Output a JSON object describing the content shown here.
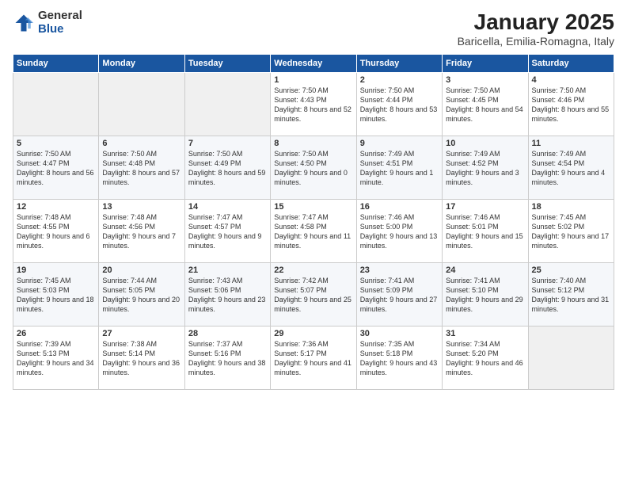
{
  "logo": {
    "general": "General",
    "blue": "Blue"
  },
  "title": "January 2025",
  "subtitle": "Baricella, Emilia-Romagna, Italy",
  "weekdays": [
    "Sunday",
    "Monday",
    "Tuesday",
    "Wednesday",
    "Thursday",
    "Friday",
    "Saturday"
  ],
  "weeks": [
    [
      {
        "day": "",
        "info": ""
      },
      {
        "day": "",
        "info": ""
      },
      {
        "day": "",
        "info": ""
      },
      {
        "day": "1",
        "info": "Sunrise: 7:50 AM\nSunset: 4:43 PM\nDaylight: 8 hours\nand 52 minutes."
      },
      {
        "day": "2",
        "info": "Sunrise: 7:50 AM\nSunset: 4:44 PM\nDaylight: 8 hours\nand 53 minutes."
      },
      {
        "day": "3",
        "info": "Sunrise: 7:50 AM\nSunset: 4:45 PM\nDaylight: 8 hours\nand 54 minutes."
      },
      {
        "day": "4",
        "info": "Sunrise: 7:50 AM\nSunset: 4:46 PM\nDaylight: 8 hours\nand 55 minutes."
      }
    ],
    [
      {
        "day": "5",
        "info": "Sunrise: 7:50 AM\nSunset: 4:47 PM\nDaylight: 8 hours\nand 56 minutes."
      },
      {
        "day": "6",
        "info": "Sunrise: 7:50 AM\nSunset: 4:48 PM\nDaylight: 8 hours\nand 57 minutes."
      },
      {
        "day": "7",
        "info": "Sunrise: 7:50 AM\nSunset: 4:49 PM\nDaylight: 8 hours\nand 59 minutes."
      },
      {
        "day": "8",
        "info": "Sunrise: 7:50 AM\nSunset: 4:50 PM\nDaylight: 9 hours\nand 0 minutes."
      },
      {
        "day": "9",
        "info": "Sunrise: 7:49 AM\nSunset: 4:51 PM\nDaylight: 9 hours\nand 1 minute."
      },
      {
        "day": "10",
        "info": "Sunrise: 7:49 AM\nSunset: 4:52 PM\nDaylight: 9 hours\nand 3 minutes."
      },
      {
        "day": "11",
        "info": "Sunrise: 7:49 AM\nSunset: 4:54 PM\nDaylight: 9 hours\nand 4 minutes."
      }
    ],
    [
      {
        "day": "12",
        "info": "Sunrise: 7:48 AM\nSunset: 4:55 PM\nDaylight: 9 hours\nand 6 minutes."
      },
      {
        "day": "13",
        "info": "Sunrise: 7:48 AM\nSunset: 4:56 PM\nDaylight: 9 hours\nand 7 minutes."
      },
      {
        "day": "14",
        "info": "Sunrise: 7:47 AM\nSunset: 4:57 PM\nDaylight: 9 hours\nand 9 minutes."
      },
      {
        "day": "15",
        "info": "Sunrise: 7:47 AM\nSunset: 4:58 PM\nDaylight: 9 hours\nand 11 minutes."
      },
      {
        "day": "16",
        "info": "Sunrise: 7:46 AM\nSunset: 5:00 PM\nDaylight: 9 hours\nand 13 minutes."
      },
      {
        "day": "17",
        "info": "Sunrise: 7:46 AM\nSunset: 5:01 PM\nDaylight: 9 hours\nand 15 minutes."
      },
      {
        "day": "18",
        "info": "Sunrise: 7:45 AM\nSunset: 5:02 PM\nDaylight: 9 hours\nand 17 minutes."
      }
    ],
    [
      {
        "day": "19",
        "info": "Sunrise: 7:45 AM\nSunset: 5:03 PM\nDaylight: 9 hours\nand 18 minutes."
      },
      {
        "day": "20",
        "info": "Sunrise: 7:44 AM\nSunset: 5:05 PM\nDaylight: 9 hours\nand 20 minutes."
      },
      {
        "day": "21",
        "info": "Sunrise: 7:43 AM\nSunset: 5:06 PM\nDaylight: 9 hours\nand 23 minutes."
      },
      {
        "day": "22",
        "info": "Sunrise: 7:42 AM\nSunset: 5:07 PM\nDaylight: 9 hours\nand 25 minutes."
      },
      {
        "day": "23",
        "info": "Sunrise: 7:41 AM\nSunset: 5:09 PM\nDaylight: 9 hours\nand 27 minutes."
      },
      {
        "day": "24",
        "info": "Sunrise: 7:41 AM\nSunset: 5:10 PM\nDaylight: 9 hours\nand 29 minutes."
      },
      {
        "day": "25",
        "info": "Sunrise: 7:40 AM\nSunset: 5:12 PM\nDaylight: 9 hours\nand 31 minutes."
      }
    ],
    [
      {
        "day": "26",
        "info": "Sunrise: 7:39 AM\nSunset: 5:13 PM\nDaylight: 9 hours\nand 34 minutes."
      },
      {
        "day": "27",
        "info": "Sunrise: 7:38 AM\nSunset: 5:14 PM\nDaylight: 9 hours\nand 36 minutes."
      },
      {
        "day": "28",
        "info": "Sunrise: 7:37 AM\nSunset: 5:16 PM\nDaylight: 9 hours\nand 38 minutes."
      },
      {
        "day": "29",
        "info": "Sunrise: 7:36 AM\nSunset: 5:17 PM\nDaylight: 9 hours\nand 41 minutes."
      },
      {
        "day": "30",
        "info": "Sunrise: 7:35 AM\nSunset: 5:18 PM\nDaylight: 9 hours\nand 43 minutes."
      },
      {
        "day": "31",
        "info": "Sunrise: 7:34 AM\nSunset: 5:20 PM\nDaylight: 9 hours\nand 46 minutes."
      },
      {
        "day": "",
        "info": ""
      }
    ]
  ]
}
